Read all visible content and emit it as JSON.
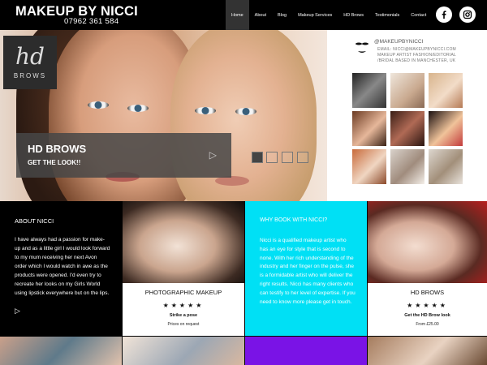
{
  "header": {
    "brand": "MAKEUP BY NICCI",
    "phone": "07962 361 584",
    "nav": [
      {
        "label": "Home",
        "active": true
      },
      {
        "label": "About"
      },
      {
        "label": "Blog"
      },
      {
        "label": "Makeup Services"
      },
      {
        "label": "HD Brows"
      },
      {
        "label": "Testimonials"
      },
      {
        "label": "Contact"
      }
    ],
    "social": [
      {
        "icon": "facebook-icon"
      },
      {
        "icon": "instagram-icon"
      }
    ]
  },
  "hero": {
    "logo_hd": "hd",
    "logo_brows": "BROWS",
    "title": "HD BROWS",
    "subtitle": "GET THE LOOK!!",
    "play_icon": "play-icon",
    "thumbs": 4,
    "active_thumb": 0
  },
  "profile": {
    "handle": "@MAKEUPBYNICCI",
    "lines": [
      "EMAIL: NICCI@MAKEUPBYNICCI.COM",
      "MAKEUP ARTIST FASHION/EDITORIAL",
      "/BRIDAL BASED IN MANCHESTER, UK"
    ]
  },
  "about": {
    "title": "ABOUT NICCI",
    "text": "I have always had a passion for make-up and as a little girl I would look forward to my mum receiving her next Avon order which I would watch in awe as the products were opened. I'd even try to recreate her looks on my Girls World using lipstick everywhere but on the lips."
  },
  "photographic": {
    "label": "PHOTOGRAPHIC MAKEUP",
    "stars": "★★★★★",
    "strong": "Strike a pose",
    "small": "Prices on request"
  },
  "why": {
    "title": "WHY BOOK WITH NICCI?",
    "text": "Nicci is a qualified makeup artist who has an eye for style that is second to none.  With her rich understanding of the industry and her finger on the pulse, she is a formidable artist who will deliver the right results. Nicci has many clients who can testify to her level of expertise. If you need to know more please get in touch."
  },
  "hdbrows": {
    "label": "HD BROWS",
    "stars": "★★★★★",
    "strong": "Get the HD Brow look",
    "small": "From £25.00"
  },
  "colors": {
    "accent_cyan": "#00e0f5",
    "bottom_purple": "#7a13e6"
  }
}
